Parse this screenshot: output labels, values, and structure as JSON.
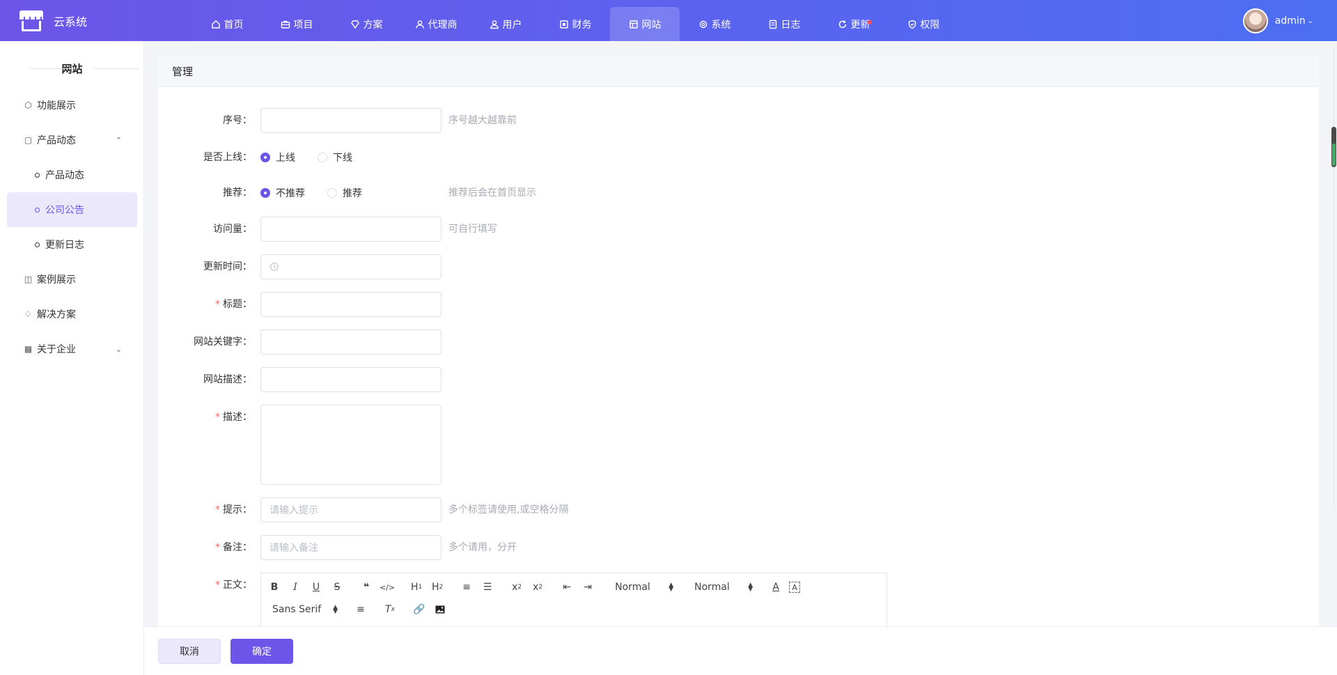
{
  "brand": {
    "name": "云系统",
    "icon": "store-icon"
  },
  "nav": {
    "items": [
      {
        "label": "首页",
        "icon": "home-icon"
      },
      {
        "label": "项目",
        "icon": "briefcase-icon"
      },
      {
        "label": "方案",
        "icon": "diamond-icon"
      },
      {
        "label": "代理商",
        "icon": "user-icon"
      },
      {
        "label": "用户",
        "icon": "users-icon"
      },
      {
        "label": "财务",
        "icon": "wallet-icon"
      },
      {
        "label": "网站",
        "icon": "layout-icon",
        "active": true
      },
      {
        "label": "系统",
        "icon": "gear-icon"
      },
      {
        "label": "日志",
        "icon": "document-icon"
      },
      {
        "label": "更新",
        "icon": "refresh-icon",
        "badge": true
      },
      {
        "label": "权限",
        "icon": "shield-icon"
      }
    ]
  },
  "user": {
    "name": "admin"
  },
  "sidebar": {
    "title": "网站",
    "items": [
      {
        "label": "功能展示",
        "icon": "cube-icon"
      },
      {
        "label": "产品动态",
        "icon": "clipboard-icon",
        "expanded": true
      },
      {
        "label": "产品动态",
        "sub": true
      },
      {
        "label": "公司公告",
        "sub": true,
        "active": true
      },
      {
        "label": "更新日志",
        "sub": true
      },
      {
        "label": "案例展示",
        "icon": "showcase-icon"
      },
      {
        "label": "解决方案",
        "icon": "diamond-icon"
      },
      {
        "label": "关于企业",
        "icon": "building-icon",
        "expanded": false
      }
    ]
  },
  "panel": {
    "title": "管理"
  },
  "form": {
    "order": {
      "label": "序号：",
      "hint": "序号越大越靠前"
    },
    "online": {
      "label": "是否上线：",
      "options": [
        "上线",
        "下线"
      ],
      "selected": "上线"
    },
    "recommend": {
      "label": "推荐：",
      "options": [
        "不推荐",
        "推荐"
      ],
      "selected": "不推荐",
      "hint": "推荐后会在首页显示"
    },
    "visits": {
      "label": "访问量：",
      "hint": "可自行填写"
    },
    "update_time": {
      "label": "更新时间："
    },
    "title": {
      "label": "标题：",
      "required": "*"
    },
    "keywords": {
      "label": "网站关键字："
    },
    "site_desc": {
      "label": "网站描述："
    },
    "description": {
      "label": "描述：",
      "required": "*"
    },
    "tips": {
      "label": "提示：",
      "required": "*",
      "placeholder": "请输入提示",
      "hint": "多个标签请使用,或空格分隔"
    },
    "remark": {
      "label": "备注：",
      "required": "*",
      "placeholder": "请输入备注",
      "hint": "多个请用，分开"
    },
    "body": {
      "label": "正文：",
      "required": "*"
    }
  },
  "editor": {
    "header_select_1": "Normal",
    "header_select_2": "Normal",
    "font_select": "Sans Serif"
  },
  "footer": {
    "cancel": "取消",
    "ok": "确定"
  },
  "colors": {
    "primary": "#6c55e8",
    "danger": "#f56c6c",
    "badge": "#ff4d4f"
  }
}
